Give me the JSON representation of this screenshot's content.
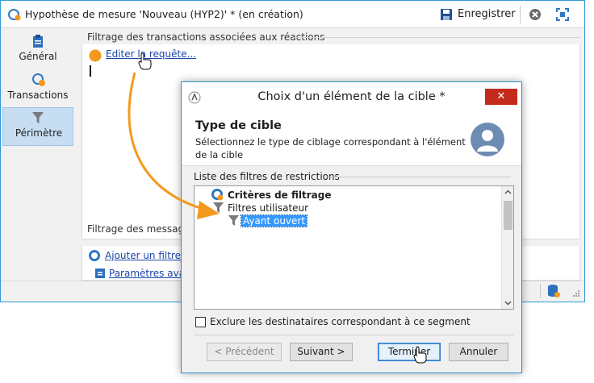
{
  "window": {
    "title": "Hypothèse de mesure 'Nouveau (HYP2)' * (en création)",
    "save_label": "Enregistrer"
  },
  "sidebar": {
    "items": [
      {
        "label": "Général",
        "icon": "clipboard-icon"
      },
      {
        "label": "Transactions",
        "icon": "transactions-icon"
      },
      {
        "label": "Périmètre",
        "icon": "funnel-icon"
      }
    ]
  },
  "content": {
    "section1_title": "Filtrage des transactions associées aux réactions",
    "edit_query_link": "Editer la requête...",
    "section2_title": "Filtrage des messages",
    "add_filter_link": "Ajouter un filtre...",
    "advanced_params_link": "Paramètres avancés..."
  },
  "dialog": {
    "title": "Choix d'un élément de la cible *",
    "close_glyph": "✕",
    "heading": "Type de cible",
    "description": "Sélectionnez le type de ciblage correspondant à l'élément de la cible",
    "list_title": "Liste des filtres de restrictions",
    "tree": [
      {
        "label": "Critères de filtrage",
        "bold": true
      },
      {
        "label": "Filtres utilisateur",
        "bold": false
      },
      {
        "label": "Ayant ouvert",
        "bold": false,
        "selected": true
      }
    ],
    "exclude_label": "Exclure les destinataires correspondant à ce segment",
    "exclude_checked": false,
    "buttons": {
      "previous": "< Précédent",
      "next": "Suivant >",
      "finish": "Terminer",
      "cancel": "Annuler"
    }
  },
  "colors": {
    "window_border": "#2e9bd6",
    "link": "#1a45a8",
    "selection": "#3399ff",
    "accent_orange": "#f39a1e",
    "close_red": "#c42b1c"
  }
}
